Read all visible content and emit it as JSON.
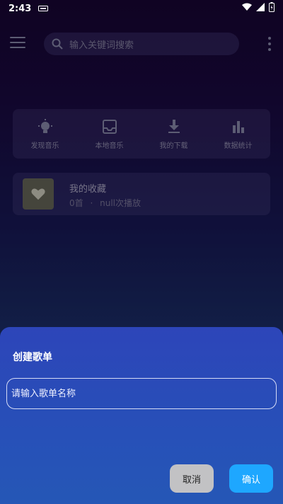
{
  "status_bar": {
    "time": "2:43",
    "icons": [
      "notification-icon",
      "wifi-icon",
      "signal-icon",
      "battery-icon"
    ]
  },
  "header": {
    "search_placeholder": "输入关键词搜索",
    "icons": [
      "menu-icon",
      "search-icon",
      "more-vertical-icon"
    ]
  },
  "quick_actions": [
    {
      "label": "发现音乐",
      "icon": "lightbulb-icon"
    },
    {
      "label": "本地音乐",
      "icon": "inbox-icon"
    },
    {
      "label": "我的下载",
      "icon": "download-icon"
    },
    {
      "label": "数据统计",
      "icon": "bar-chart-icon"
    }
  ],
  "favorites": {
    "title": "我的收藏",
    "count": "0首",
    "separator": "·",
    "plays": "null次播放",
    "icon": "heart-icon"
  },
  "dialog": {
    "title": "创建歌单",
    "input_placeholder": "请输入歌单名称",
    "input_value": "",
    "cancel_label": "取消",
    "confirm_label": "确认"
  },
  "colors": {
    "sheet": "#2d45b9",
    "confirm": "#1ea7ff",
    "cancel": "#c2c2c4"
  }
}
